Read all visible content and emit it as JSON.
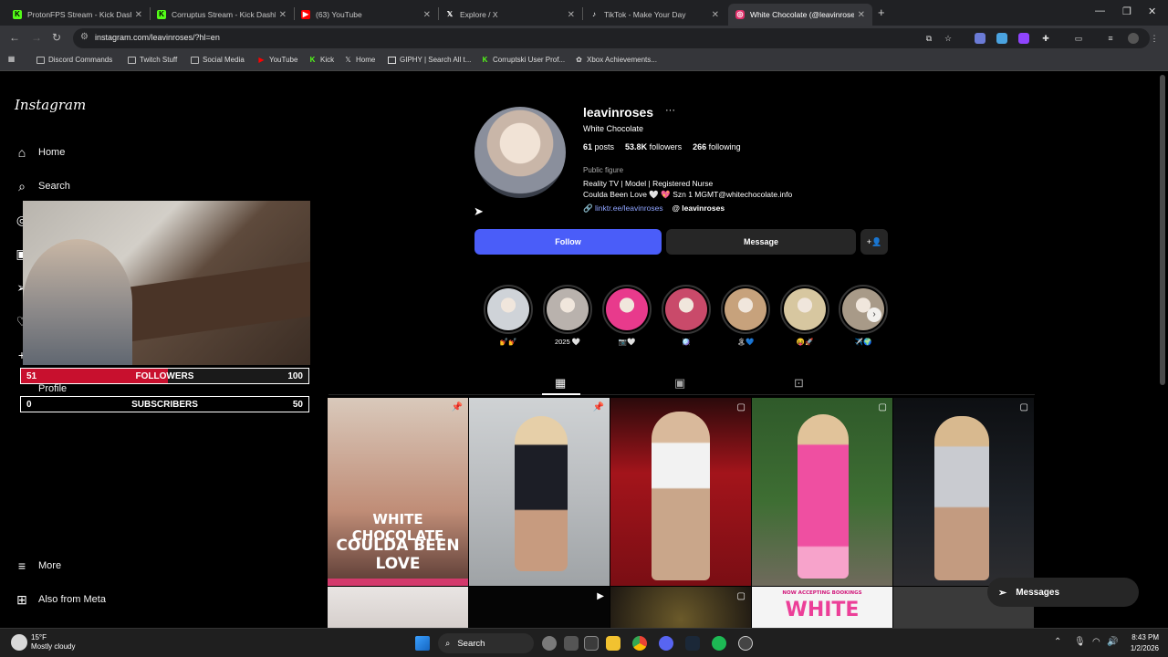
{
  "browser": {
    "tabs": [
      {
        "title": "ProtonFPS Stream - Kick Dashb",
        "icon": "kick-icon",
        "color": "#53fc18"
      },
      {
        "title": "Corruptus Stream - Kick Dashb",
        "icon": "kick-icon",
        "color": "#53fc18"
      },
      {
        "title": "(63) YouTube",
        "icon": "youtube-icon",
        "color": "#ff0000"
      },
      {
        "title": "Explore / X",
        "icon": "x-icon",
        "color": "#ffffff"
      },
      {
        "title": "TikTok - Make Your Day",
        "icon": "tiktok-icon",
        "color": "#ffffff"
      },
      {
        "title": "White Chocolate (@leavinrose",
        "icon": "instagram-icon",
        "color": "#e1306c"
      }
    ],
    "url": "instagram.com/leavinroses/?hl=en",
    "bookmarks": [
      {
        "label": "Discord Commands",
        "icon": "folder-icon"
      },
      {
        "label": "Twitch Stuff",
        "icon": "folder-icon"
      },
      {
        "label": "Social Media",
        "icon": "folder-icon"
      },
      {
        "label": "YouTube",
        "icon": "youtube-icon"
      },
      {
        "label": "Kick",
        "icon": "kick-icon"
      },
      {
        "label": "Home",
        "icon": "x-icon"
      },
      {
        "label": "GIPHY | Search All t...",
        "icon": "giphy-icon"
      },
      {
        "label": "Corruptski User Prof...",
        "icon": "kick-icon"
      },
      {
        "label": "Xbox Achievements...",
        "icon": "xbox-icon"
      }
    ]
  },
  "sidebar": {
    "logo": "Instagram",
    "home": "Home",
    "search": "Search",
    "profile": "Profile",
    "more": "More",
    "also_from_meta": "Also from Meta"
  },
  "profile": {
    "username": "leavinroses",
    "full_name": "White Chocolate",
    "posts_count": "61",
    "posts_label": "posts",
    "followers_count": "53.8K",
    "followers_label": "followers",
    "following_count": "266",
    "following_label": "following",
    "category": "Public figure",
    "bio_line1": "Reality TV | Model | Registered Nurse",
    "bio_line2": "Coulda Been Love 🤍 💖 Szn 1 MGMT@whitechocolate.info",
    "link": "linktr.ee/leavinroses",
    "threads": "leavinroses",
    "follow_label": "Follow",
    "message_label": "Message"
  },
  "highlights": [
    {
      "label": "💅💅",
      "color": "#cfd3d8"
    },
    {
      "label": "2025 🤍",
      "color": "#b9b2ad"
    },
    {
      "label": "📷🤍",
      "color": "#e83a8c"
    },
    {
      "label": "🪩",
      "color": "#c94a6a"
    },
    {
      "label": "🏝💙",
      "color": "#c7a27c"
    },
    {
      "label": "😝🚀",
      "color": "#d7c7a0"
    },
    {
      "label": "✈️🌍",
      "color": "#a89a88"
    }
  ],
  "posts": [
    {
      "overlay1": "WHITE CHOCOLATE",
      "overlay2": "COULDA BEEN LOVE"
    },
    {},
    {},
    {},
    {},
    {},
    {},
    {
      "overlay_top": "NOW ACCEPTING BOOKINGS",
      "overlay_big": "WHITE"
    }
  ],
  "messages_pill": "Messages",
  "stream_overlay": {
    "followers_current": "51",
    "followers_label": "FOLLOWERS",
    "followers_goal": "100",
    "followers_progress": 0.51,
    "subscribers_current": "0",
    "subscribers_label": "SUBSCRIBERS",
    "subscribers_goal": "50",
    "subscribers_progress": 0
  },
  "taskbar": {
    "temp": "15°F",
    "weather": "Mostly cloudy",
    "search": "Search",
    "time": "8:43 PM",
    "date": "1/2/2026"
  }
}
